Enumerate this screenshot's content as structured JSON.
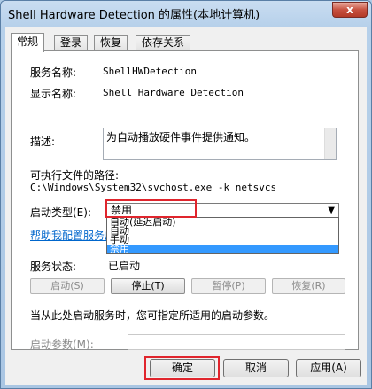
{
  "window": {
    "title": "Shell Hardware Detection 的属性(本地计算机)",
    "close_glyph": "x"
  },
  "tabs": [
    "常规",
    "登录",
    "恢复",
    "依存关系"
  ],
  "general": {
    "service_name_label": "服务名称:",
    "service_name_value": "ShellHWDetection",
    "display_name_label": "显示名称:",
    "display_name_value": "Shell Hardware Detection",
    "description_label": "描述:",
    "description_value": "为自动播放硬件事件提供通知。",
    "exe_path_label": "可执行文件的路径:",
    "exe_path_value": "C:\\Windows\\System32\\svchost.exe -k netsvcs",
    "startup_type_label": "启动类型(E):",
    "startup_type_value": "禁用",
    "startup_options": [
      "自动(延迟启动)",
      "自动",
      "手动",
      "禁用"
    ],
    "help_link": "帮助我配置服务启",
    "status_label": "服务状态:",
    "status_value": "已启动",
    "buttons": {
      "start": "启动(S)",
      "stop": "停止(T)",
      "pause": "暂停(P)",
      "resume": "恢复(R)"
    },
    "hint": "当从此处启动服务时，您可指定所适用的启动参数。",
    "start_params_label": "启动参数(M):",
    "start_params_value": ""
  },
  "footer": {
    "ok": "确定",
    "cancel": "取消",
    "apply": "应用(A)"
  },
  "colors": {
    "highlight": "#e0252d",
    "selection": "#3399ff"
  }
}
